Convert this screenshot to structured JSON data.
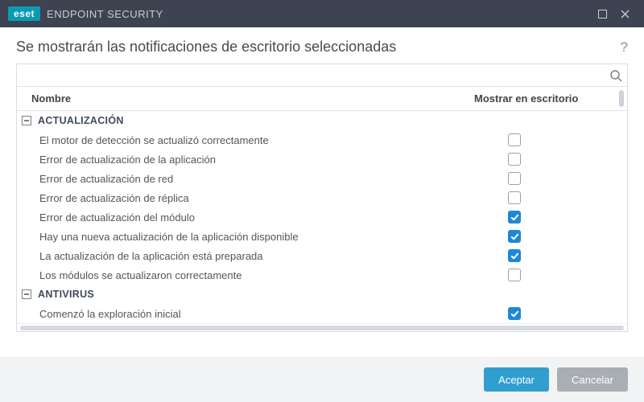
{
  "brand": {
    "badge": "eset",
    "title": "ENDPOINT SECURITY"
  },
  "page": {
    "title": "Se mostrarán las notificaciones de escritorio seleccionadas"
  },
  "search": {
    "placeholder": ""
  },
  "columns": {
    "name": "Nombre",
    "show": "Mostrar en escritorio"
  },
  "groups": [
    {
      "label": "ACTUALIZACIÓN",
      "expanded": true,
      "items": [
        {
          "label": "El motor de detección se actualizó correctamente",
          "checked": false
        },
        {
          "label": "Error de actualización de la aplicación",
          "checked": false
        },
        {
          "label": "Error de actualización de red",
          "checked": false
        },
        {
          "label": "Error de actualización de réplica",
          "checked": false
        },
        {
          "label": "Error de actualización del módulo",
          "checked": true
        },
        {
          "label": "Hay una nueva actualización de la aplicación disponible",
          "checked": true
        },
        {
          "label": "La actualización de la aplicación está preparada",
          "checked": true
        },
        {
          "label": "Los módulos se actualizaron correctamente",
          "checked": false
        }
      ]
    },
    {
      "label": "ANTIVIRUS",
      "expanded": true,
      "items": [
        {
          "label": "Comenzó la exploración inicial",
          "checked": true
        }
      ]
    }
  ],
  "footer": {
    "ok": "Aceptar",
    "cancel": "Cancelar"
  }
}
